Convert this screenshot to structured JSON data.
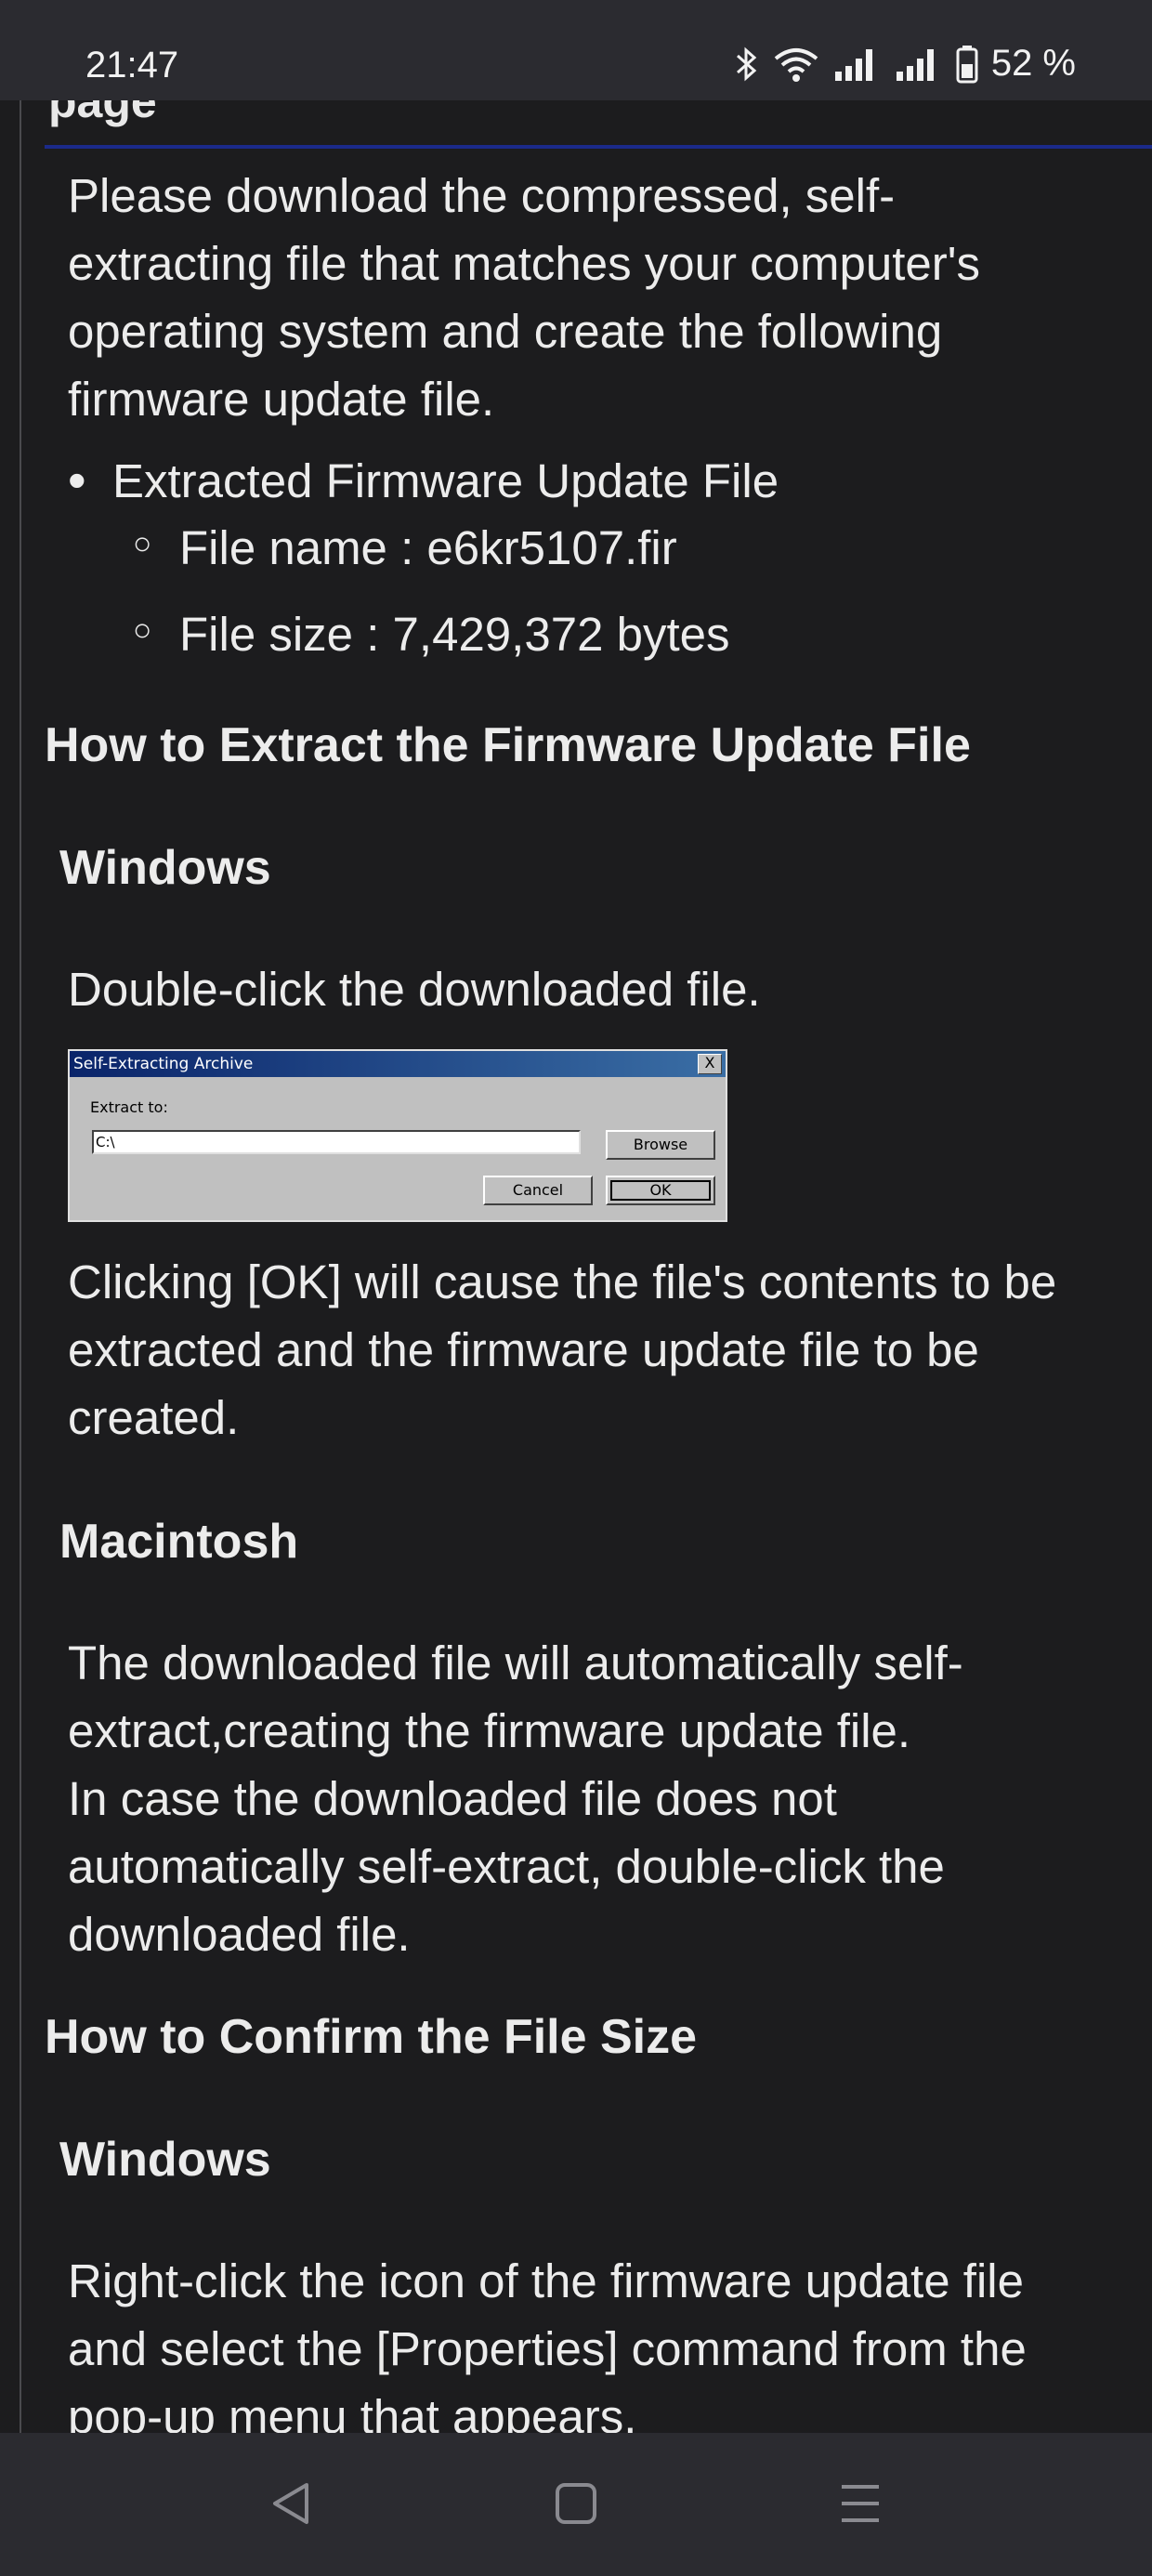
{
  "status_bar": {
    "time": "21:47",
    "battery": "52 %",
    "icons": [
      "bluetooth-icon",
      "wifi-icon",
      "signal-icon",
      "signal-icon",
      "battery-icon"
    ]
  },
  "page": {
    "top_heading_partial": "page",
    "intro_lines": [
      "Please download the compressed, self-",
      "extracting file that matches your computer's",
      "operating system and create the following",
      "firmware update file."
    ],
    "bullet": "Extracted Firmware Update File",
    "sub_items": [
      "File name : e6kr5107.fir",
      "File size : 7,429,372 bytes"
    ],
    "section_extract": "How to Extract the Firmware Update File",
    "windows_heading": "Windows",
    "windows_text": "Double-click the downloaded file.",
    "dialog": {
      "title": "Self-Extracting Archive",
      "close": "X",
      "extract_label": "Extract to:",
      "path_value": "C:\\",
      "browse": "Browse",
      "cancel": "Cancel",
      "ok": "OK"
    },
    "ok_lines": [
      "Clicking [OK] will cause the file's contents to be",
      "extracted and the firmware update file to be",
      "created."
    ],
    "mac_heading": "Macintosh",
    "mac_lines": [
      "The downloaded file will automatically self-",
      "extract,creating the firmware update file.",
      "In case the downloaded file does not",
      "automatically self-extract, double-click the",
      "downloaded file."
    ],
    "section_confirm": "How to Confirm the File Size",
    "windows_heading_2": "Windows",
    "confirm_lines": [
      "Right-click the icon of the firmware update file",
      "and select the [Properties] command from the",
      "pop-up menu that appears."
    ]
  },
  "nav_bar": {
    "icons": [
      "back-icon",
      "home-icon",
      "recents-icon"
    ]
  }
}
